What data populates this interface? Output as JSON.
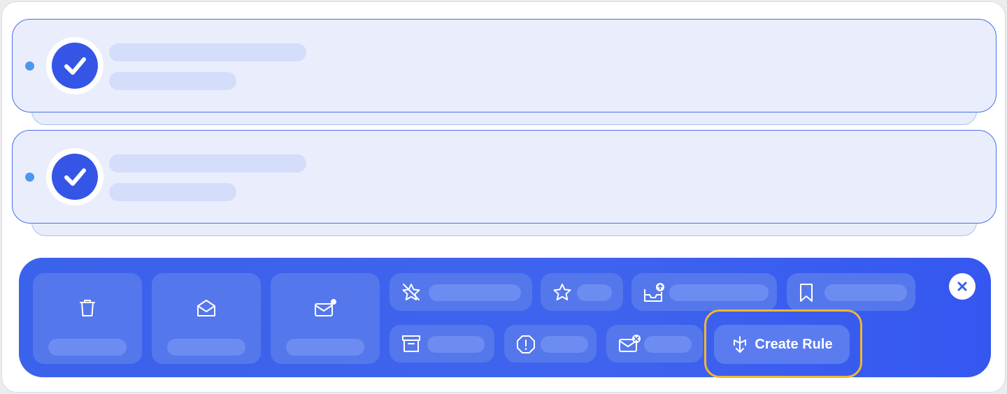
{
  "cards": [
    {
      "status": "selected",
      "check_icon": "check-icon"
    },
    {
      "status": "selected",
      "check_icon": "check-icon"
    }
  ],
  "toolbar": {
    "create_rule_label": "Create Rule",
    "accent_color": "#3f63ee",
    "highlight_color": "#f0b732",
    "icons": [
      "trash-icon",
      "envelope-open-icon",
      "envelope-unread-icon",
      "star-slash-icon",
      "star-icon",
      "inbox-move-icon",
      "bookmark-icon",
      "archive-icon",
      "alert-icon",
      "envelope-block-icon",
      "rule-icon",
      "close-icon"
    ]
  }
}
